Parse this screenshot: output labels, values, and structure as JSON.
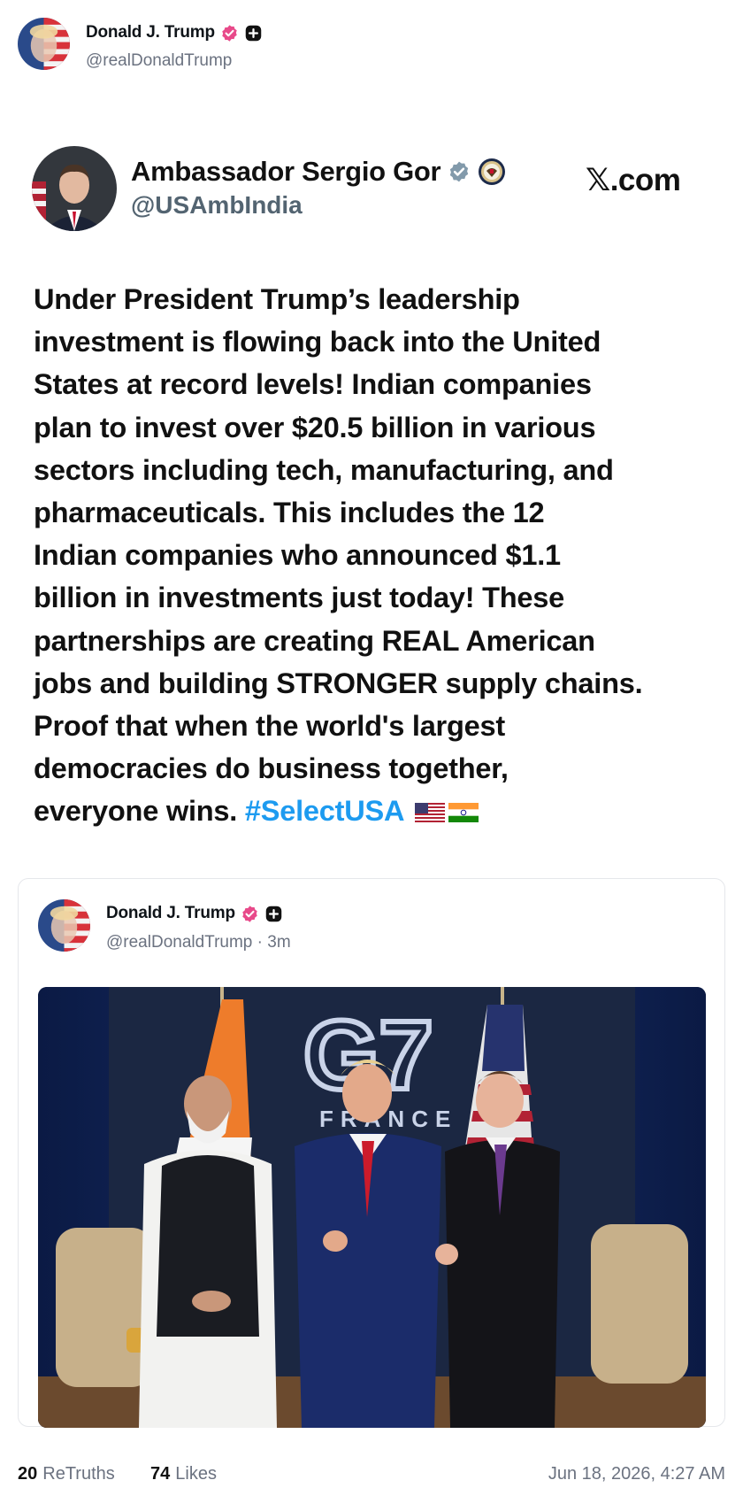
{
  "post": {
    "author_name": "Donald J. Trump",
    "author_handle": "@realDonaldTrump"
  },
  "embedded_x_post": {
    "author_name": "Ambassador Sergio Gor",
    "author_handle": "@USAmbIndia",
    "site": "𝕏.com",
    "text_lines": [
      "Under President Trump’s leadership",
      "investment is flowing back into the United",
      "States at record levels! Indian companies",
      "plan to invest over $20.5 billion in various",
      "sectors including tech, manufacturing, and",
      "pharmaceuticals. This includes the 12",
      "Indian companies who announced $1.1",
      "billion in investments just today! These",
      "partnerships are creating REAL American",
      "jobs and building STRONGER supply chains.",
      "Proof that when the world's largest",
      "democracies do business together,"
    ],
    "last_line_text": "everyone wins.",
    "hashtag": "#SelectUSA",
    "flags": [
      "us-flag-icon",
      "india-flag-icon"
    ]
  },
  "quoted_post": {
    "author_name": "Donald J. Trump",
    "author_handle": "@realDonaldTrump",
    "separator": "·",
    "time_ago": "3m",
    "photo_backdrop_text": "G7",
    "photo_backdrop_subtext": "FRANCE"
  },
  "footer": {
    "retruths_count": "20",
    "retruths_label": "ReTruths",
    "likes_count": "74",
    "likes_label": "Likes",
    "timestamp": "Jun 18, 2026, 4:27 AM"
  },
  "colors": {
    "verified_truth": "#e84a8a",
    "verified_x": "#829aab",
    "hashtag": "#1d9bf0",
    "muted": "#6b7280"
  }
}
